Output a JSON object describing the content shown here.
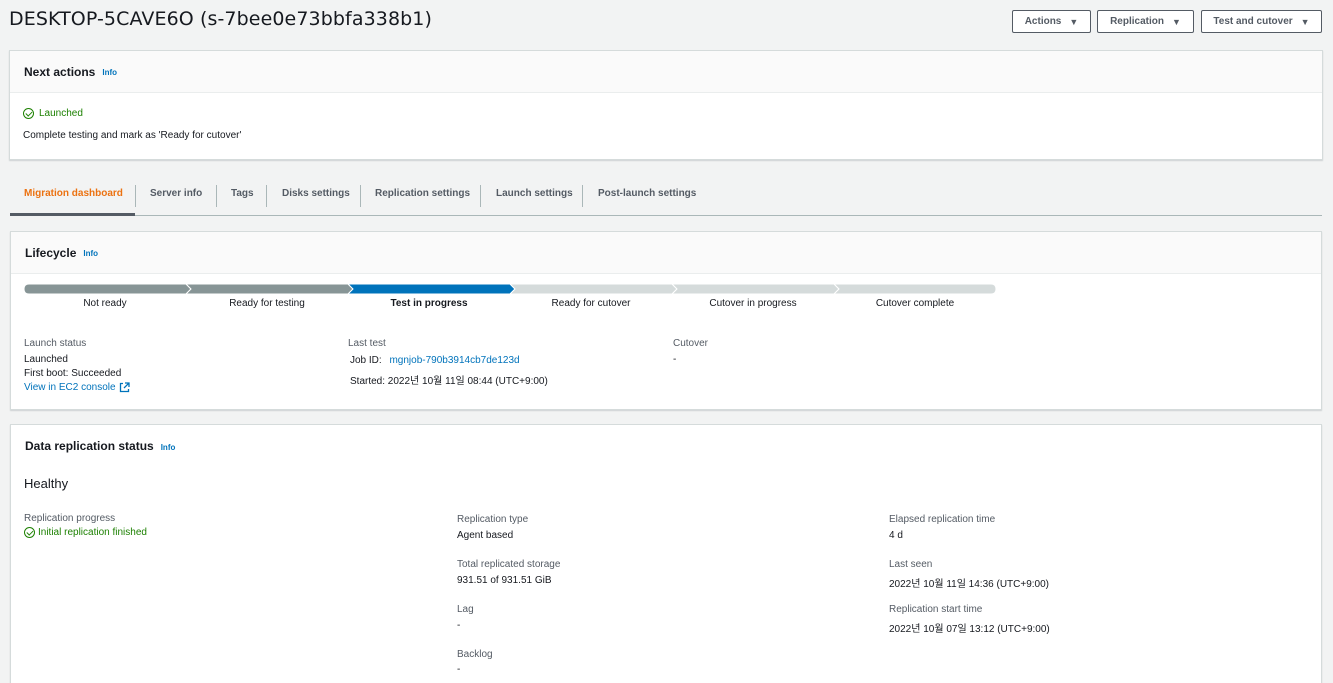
{
  "page": {
    "title": "DESKTOP-5CAVE6O (s-7bee0e73bbfa338b1)"
  },
  "header_buttons": {
    "actions": "Actions",
    "replication": "Replication",
    "test_cutover": "Test and cutover"
  },
  "next_actions": {
    "title": "Next actions",
    "info": "Info",
    "status": "Launched",
    "message": "Complete testing and mark as 'Ready for cutover'"
  },
  "tabs": [
    {
      "label": "Migration dashboard",
      "active": true
    },
    {
      "label": "Server info"
    },
    {
      "label": "Tags"
    },
    {
      "label": "Disks settings"
    },
    {
      "label": "Replication settings"
    },
    {
      "label": "Launch settings"
    },
    {
      "label": "Post-launch settings"
    }
  ],
  "lifecycle": {
    "title": "Lifecycle",
    "info": "Info",
    "stages": [
      {
        "label": "Not ready",
        "state": "done"
      },
      {
        "label": "Ready for testing",
        "state": "done"
      },
      {
        "label": "Test in progress",
        "state": "active"
      },
      {
        "label": "Ready for cutover",
        "state": "pending"
      },
      {
        "label": "Cutover in progress",
        "state": "pending"
      },
      {
        "label": "Cutover complete",
        "state": "pending"
      }
    ],
    "colors": {
      "done": "#879596",
      "active": "#0073bb",
      "pending": "#d5dbdb"
    },
    "launch_status": {
      "label": "Launch status",
      "value": "Launched",
      "first_boot": "First boot: Succeeded",
      "ec2_link": "View in EC2 console"
    },
    "last_test": {
      "label": "Last test",
      "job_id_label": "Job ID:",
      "job_id": "mgnjob-790b3914cb7de123d",
      "started": "Started: 2022년 10월 11일 08:44 (UTC+9:00)"
    },
    "cutover": {
      "label": "Cutover",
      "value": "-"
    }
  },
  "data_replication": {
    "title": "Data replication status",
    "info": "Info",
    "health": "Healthy",
    "progress_label": "Replication progress",
    "progress_value": "Initial replication finished",
    "type_label": "Replication type",
    "type_value": "Agent based",
    "storage_label": "Total replicated storage",
    "storage_value": "931.51 of 931.51 GiB",
    "lag_label": "Lag",
    "lag_value": "-",
    "backlog_label": "Backlog",
    "backlog_value": "-",
    "elapsed_label": "Elapsed replication time",
    "elapsed_value": "4 d",
    "last_seen_label": "Last seen",
    "last_seen_value": "2022년 10월 11일 14:36 (UTC+9:00)",
    "start_label": "Replication start time",
    "start_value": "2022년 10월 07일 13:12 (UTC+9:00)"
  }
}
